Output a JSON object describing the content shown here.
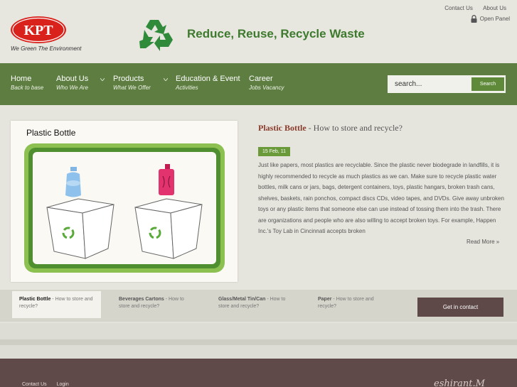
{
  "header": {
    "logo_text": "KPT",
    "logo_tagline": "We Green The Environment",
    "site_title": "Reduce, Reuse, Recycle Waste",
    "top_links": [
      "Contact Us",
      "About Us"
    ],
    "open_panel": "Open Panel",
    "brand_color": "#3e7a2e"
  },
  "nav": {
    "items": [
      {
        "label": "Home",
        "sub": "Back to base"
      },
      {
        "label": "About Us",
        "sub": "Who We Are"
      },
      {
        "label": "Products",
        "sub": "What We Offer"
      },
      {
        "label": "Education & Event",
        "sub": "Activities"
      },
      {
        "label": "Career",
        "sub": "Jobs Vacancy"
      }
    ],
    "background": "#5d7d41"
  },
  "search": {
    "placeholder": "search...",
    "button_label": "Search"
  },
  "feature": {
    "image_title": "Plastic Bottle",
    "article_title_bold": "Plastic Bottle",
    "article_title_rest": " - How to store and recycle?",
    "date": "15 Feb, 11",
    "body": "Just like papers, most plastics are recyclable. Since the plastic never biodegrade in landfills, it is highly recommended to recycle as much plastics as we can. Make sure to recycle plastic water bottles, milk cans or jars, bags, detergent containers, toys, plastic hangars, broken trash cans, shelves, baskets, rain ponchos, compact discs CDs, video tapes, and DVDs. Give away unbroken toys or any plastic items that someone else can use instead of tossing them into the trash. There are organizations and people who are also willing to accept broken toys. For example, Happen Inc.'s Toy Lab in Cincinnati accepts broken",
    "read_more": "Read More »"
  },
  "tabs": [
    {
      "title": "Plastic Bottle",
      "desc": " - How to store and recycle?"
    },
    {
      "title": "Beverages Cartons",
      "desc": " - How to store and recycle?"
    },
    {
      "title": "Glass/Metal Tin/Can",
      "desc": " - How to store and recycle?"
    },
    {
      "title": "Paper",
      "desc": " - How to store and recycle?"
    }
  ],
  "contact_button": "Get in contact",
  "footer": {
    "links": [
      "Contact Us",
      "Login"
    ],
    "signature": "eshirant.M"
  }
}
